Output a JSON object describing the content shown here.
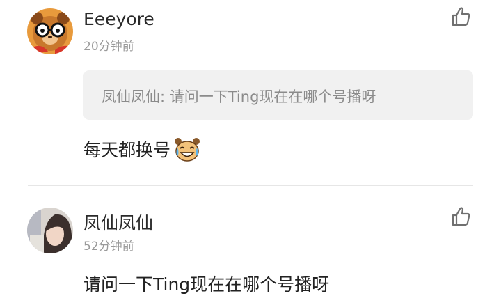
{
  "comments": [
    {
      "username": "Eeeyore",
      "time": "20分钟前",
      "avatar_icon": "cartoon-bear-with-glasses-avatar",
      "quote": "凤仙凤仙: 请问一下Ting现在在哪个号播呀",
      "text": "每天都换号",
      "emoji_icon": "laughing-crying-emoji",
      "like_icon": "thumbs-up-icon"
    },
    {
      "username": "凤仙凤仙",
      "time": "52分钟前",
      "avatar_icon": "girl-photo-avatar",
      "text": "请问一下Ting现在在哪个号播呀",
      "like_icon": "thumbs-up-icon"
    }
  ],
  "colors": {
    "username": "#2a2a2a",
    "timestamp": "#9a9a9a",
    "quote_bg": "#f1f1f1",
    "quote_text": "#8b8b8b",
    "divider": "#e6e6e6",
    "icon": "#707070"
  }
}
